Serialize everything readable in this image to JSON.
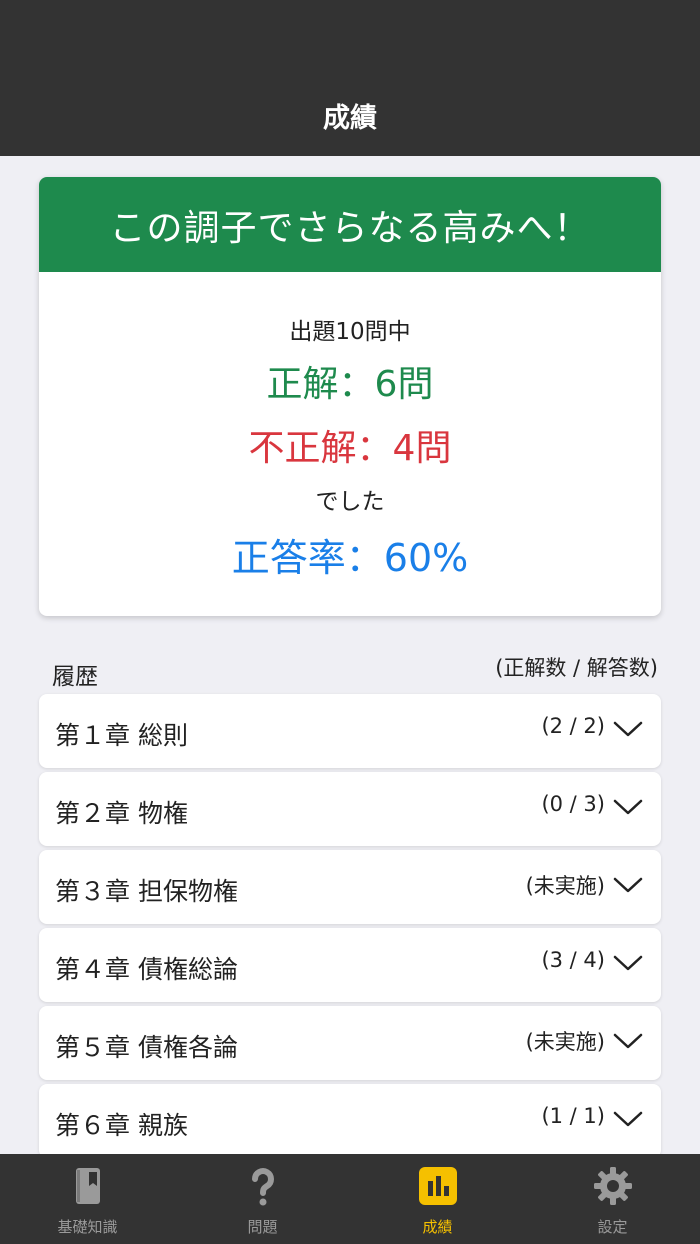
{
  "header": {
    "title": "成績"
  },
  "result": {
    "banner": "この調子でさらなる高みへ！",
    "total": "出題10問中",
    "correct": "正解：6問",
    "wrong": "不正解：4問",
    "deshita": "でした",
    "rate": "正答率：60%"
  },
  "history": {
    "label": "履歴",
    "caption": "(正解数 / 解答数)",
    "chapters": [
      {
        "title": "第１章 総則",
        "score": "(2 / 2)"
      },
      {
        "title": "第２章 物権",
        "score": "(0 / 3)"
      },
      {
        "title": "第３章 担保物権",
        "score": "(未実施)"
      },
      {
        "title": "第４章 債権総論",
        "score": "(3 / 4)"
      },
      {
        "title": "第５章 債権各論",
        "score": "(未実施)"
      },
      {
        "title": "第６章 親族",
        "score": "(1 / 1)"
      }
    ]
  },
  "tabs": [
    {
      "label": "基礎知識",
      "icon": "book-icon"
    },
    {
      "label": "問題",
      "icon": "question-icon"
    },
    {
      "label": "成績",
      "icon": "chart-icon",
      "active": true
    },
    {
      "label": "設定",
      "icon": "gear-icon"
    }
  ],
  "colors": {
    "header_bg": "#333333",
    "banner_green": "#1e8a4d",
    "wrong_red": "#d9363e",
    "rate_blue": "#1a7fe8",
    "tab_active": "#f5c000",
    "tab_inactive": "#9a9a9a"
  }
}
